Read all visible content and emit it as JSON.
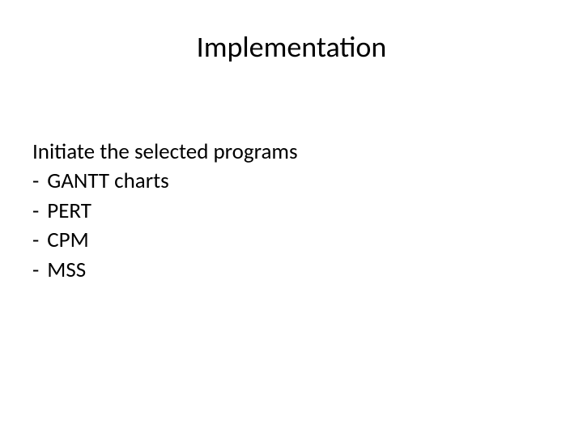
{
  "title": "Implementation",
  "intro": "Initiate the selected programs",
  "bullets": [
    {
      "dash": "-",
      "text": "GANTT charts"
    },
    {
      "dash": "-",
      "text": "PERT"
    },
    {
      "dash": "-",
      "text": "CPM"
    },
    {
      "dash": "-",
      "text": "MSS"
    }
  ]
}
